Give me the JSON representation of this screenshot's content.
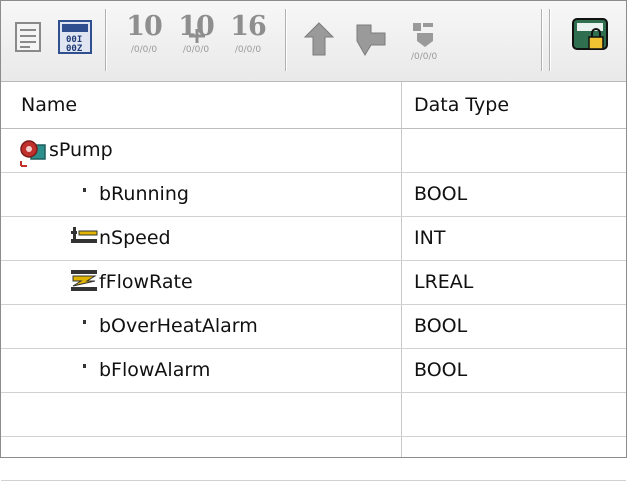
{
  "toolbar": {
    "buttons": [
      {
        "name": "declaration-view",
        "icon": "textual-view-icon"
      },
      {
        "name": "tabular-view",
        "icon": "tabular-view-icon"
      },
      {
        "name": "display-decimal",
        "big": "10",
        "small": "/0/0/0"
      },
      {
        "name": "display-binary",
        "big": "10",
        "small": "/0/0/0"
      },
      {
        "name": "display-hex",
        "big": "16",
        "small": "/0/0/0"
      },
      {
        "name": "move-up",
        "icon": "move-up-icon"
      },
      {
        "name": "move-down",
        "icon": "move-down-icon"
      },
      {
        "name": "fill-values",
        "icon": "fill-values-icon"
      },
      {
        "name": "lock",
        "icon": "lock-icon"
      }
    ]
  },
  "table": {
    "headers": {
      "name": "Name",
      "type": "Data Type"
    },
    "rows": [
      {
        "name": "sPump",
        "type": "",
        "icon": "struct-icon",
        "indent": 0
      },
      {
        "name": "bRunning",
        "type": "BOOL",
        "icon": "bool-dot-icon",
        "indent": 1
      },
      {
        "name": "nSpeed",
        "type": "INT",
        "icon": "int-variable-icon",
        "indent": 1
      },
      {
        "name": "fFlowRate",
        "type": "LREAL",
        "icon": "real-variable-icon",
        "indent": 1
      },
      {
        "name": "bOverHeatAlarm",
        "type": "BOOL",
        "icon": "bool-dot-icon",
        "indent": 1
      },
      {
        "name": "bFlowAlarm",
        "type": "BOOL",
        "icon": "bool-dot-icon",
        "indent": 1
      },
      {
        "name": "",
        "type": "",
        "icon": "",
        "indent": 0
      },
      {
        "name": "",
        "type": "",
        "icon": "",
        "indent": 0
      }
    ]
  },
  "colors": {
    "toolbar_bg": "#eeeeee",
    "border": "#8c8c8c",
    "grid_line": "#d2d2d2",
    "struct_red": "#c0302c",
    "struct_teal": "#2d8f8c",
    "icon_yellow": "#e1b400"
  }
}
